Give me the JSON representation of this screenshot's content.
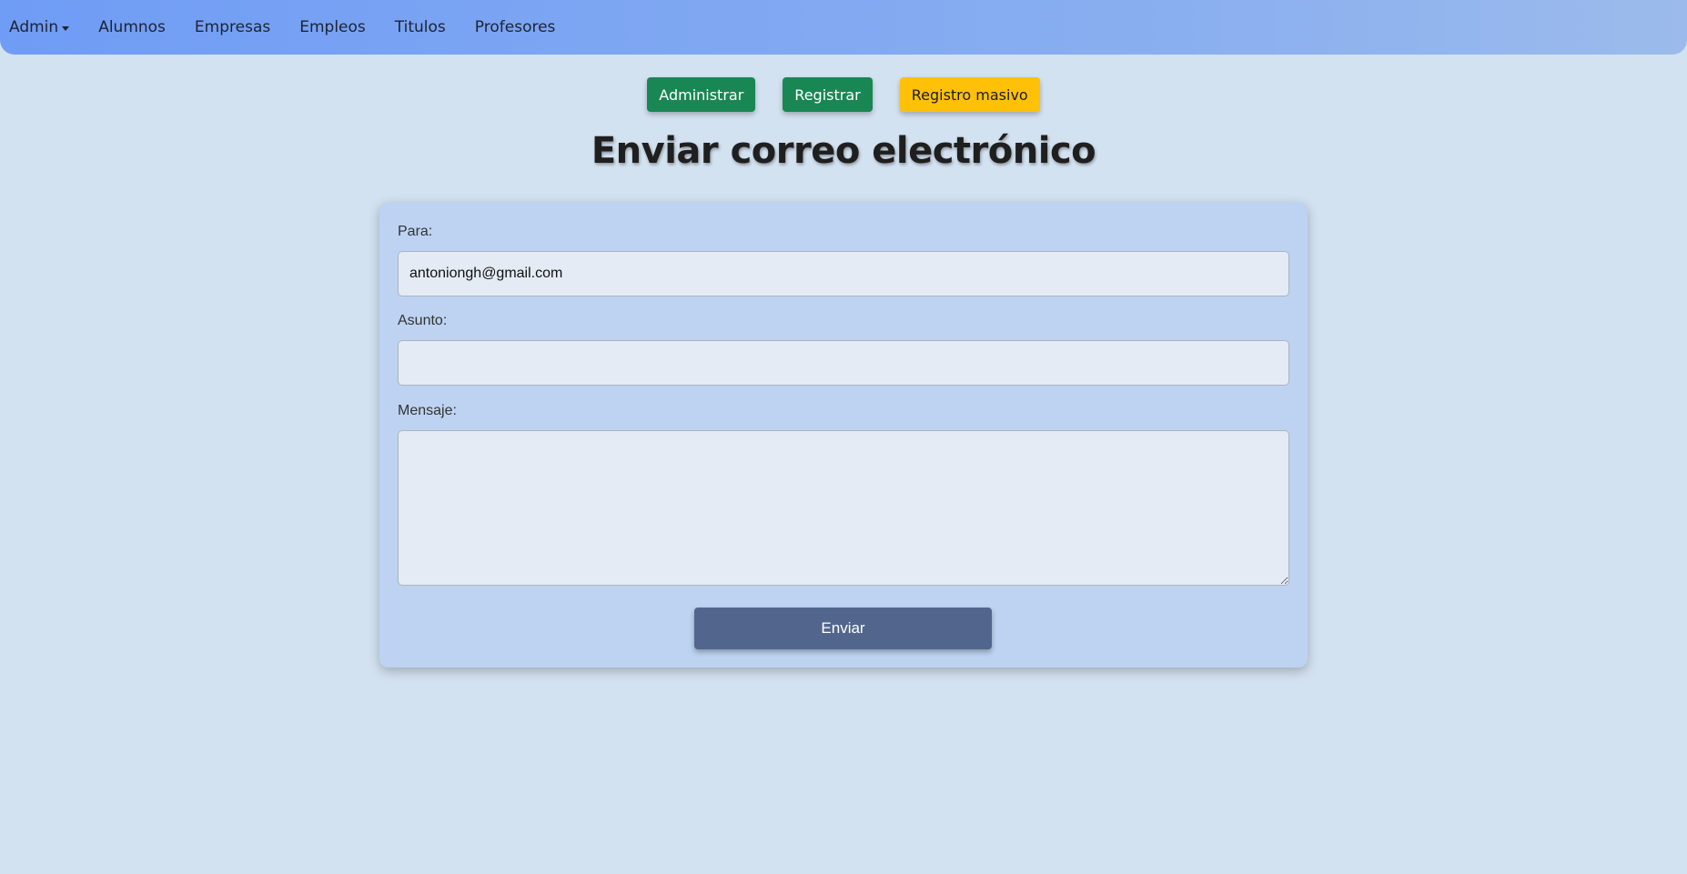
{
  "nav": {
    "dropdown_label": "Admin",
    "links": [
      "Alumnos",
      "Empresas",
      "Empleos",
      "Titulos",
      "Profesores"
    ]
  },
  "actions": {
    "administrar": "Administrar",
    "registrar": "Registrar",
    "registro_masivo": "Registro masivo"
  },
  "page": {
    "title": "Enviar correo electrónico"
  },
  "form": {
    "to_label": "Para:",
    "to_value": "antoniongh@gmail.com",
    "subject_label": "Asunto:",
    "subject_value": "",
    "message_label": "Mensaje:",
    "message_value": "",
    "submit_label": "Enviar"
  },
  "colors": {
    "navbar_start": "#6f9cf5",
    "navbar_end": "#9cbbec",
    "background": "#d3e2f1",
    "card": "#bdd3f1",
    "success": "#198754",
    "warning": "#ffc107",
    "submit": "#52668d"
  }
}
